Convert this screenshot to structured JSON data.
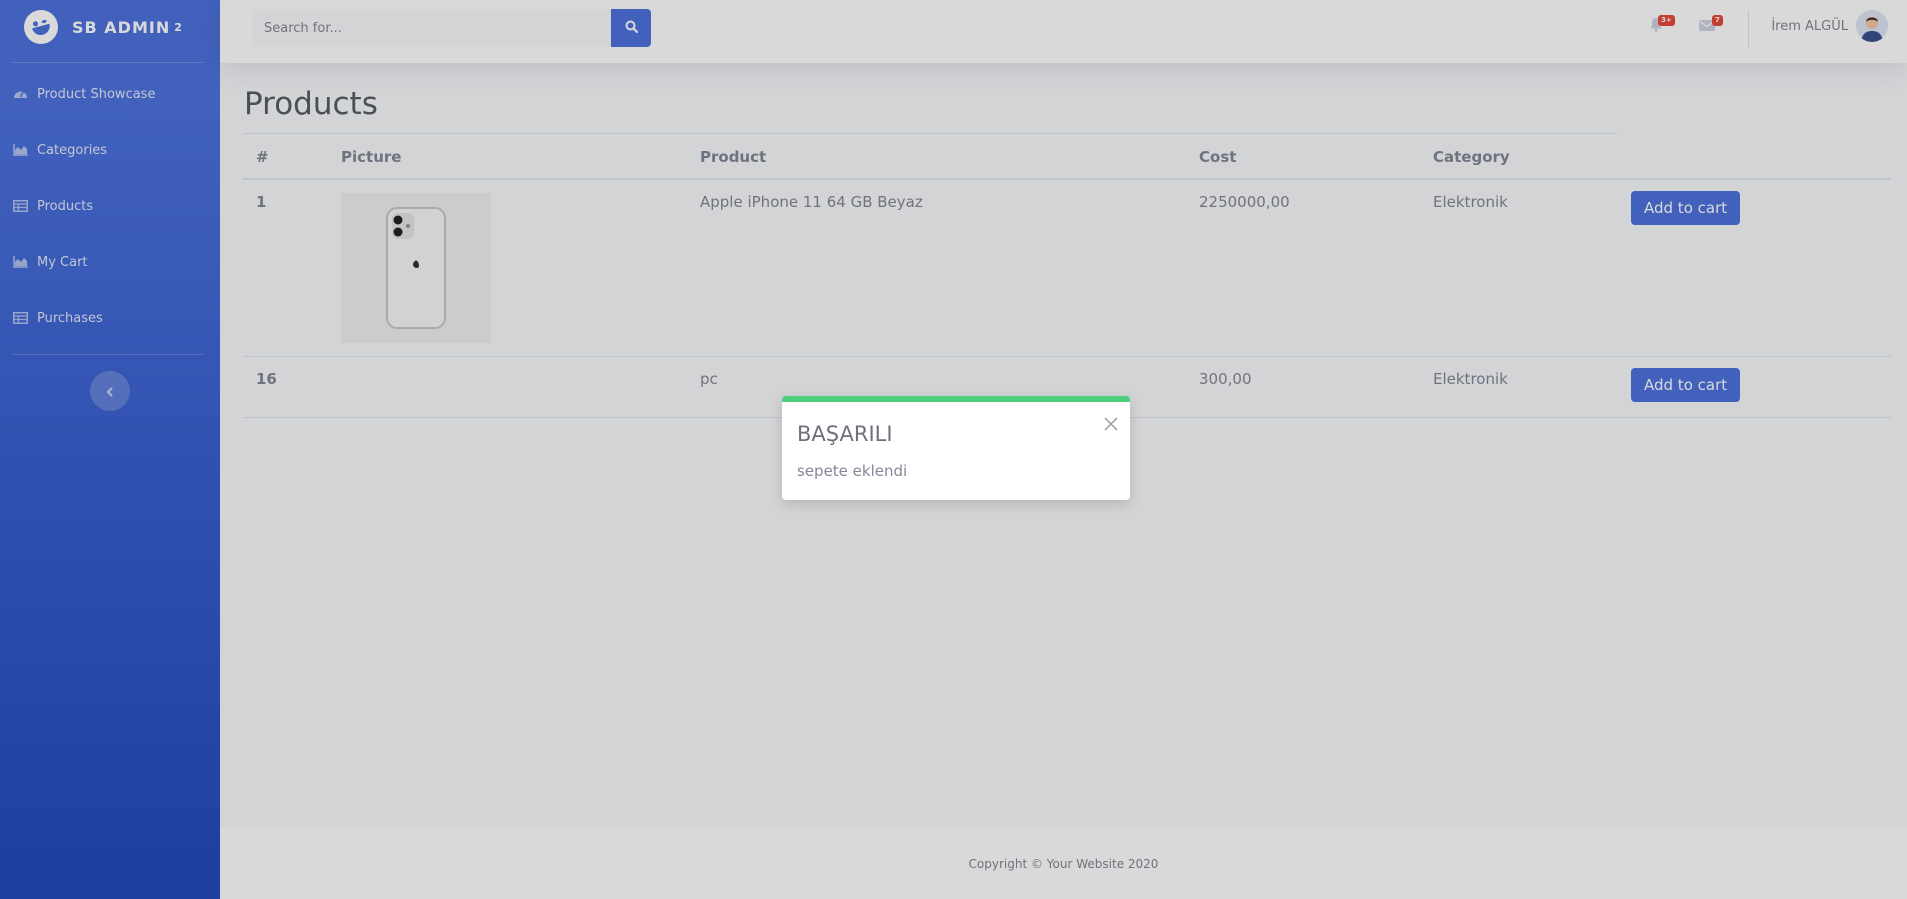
{
  "sidebar": {
    "brand": "SB ADMIN",
    "brand_sup": "2",
    "items": [
      {
        "label": "Product Showcase",
        "icon": "tachometer-icon"
      },
      {
        "label": "Categories",
        "icon": "chart-area-icon"
      },
      {
        "label": "Products",
        "icon": "table-icon"
      },
      {
        "label": "My Cart",
        "icon": "chart-area-icon"
      },
      {
        "label": "Purchases",
        "icon": "table-icon"
      }
    ]
  },
  "topbar": {
    "search_placeholder": "Search for...",
    "alerts_badge": "3+",
    "messages_badge": "7",
    "user_name": "İrem ALGÜL"
  },
  "page": {
    "title": "Products",
    "table": {
      "headers": [
        "#",
        "Picture",
        "Product",
        "Cost",
        "Category"
      ],
      "rows": [
        {
          "id": "1",
          "product": "Apple iPhone 11 64 GB Beyaz",
          "cost": "2250000,00",
          "category": "Elektronik",
          "button": "Add to cart"
        },
        {
          "id": "16",
          "product": "pc",
          "cost": "300,00",
          "category": "Elektronik",
          "button": "Add to cart"
        }
      ]
    }
  },
  "footer": {
    "copyright": "Copyright © Your Website 2020"
  },
  "toast": {
    "title": "BAŞARILI",
    "message": "sepete eklendi",
    "accent": "#4dcf7c"
  },
  "colors": {
    "primary": "#4e73df",
    "danger": "#e74a3b"
  }
}
